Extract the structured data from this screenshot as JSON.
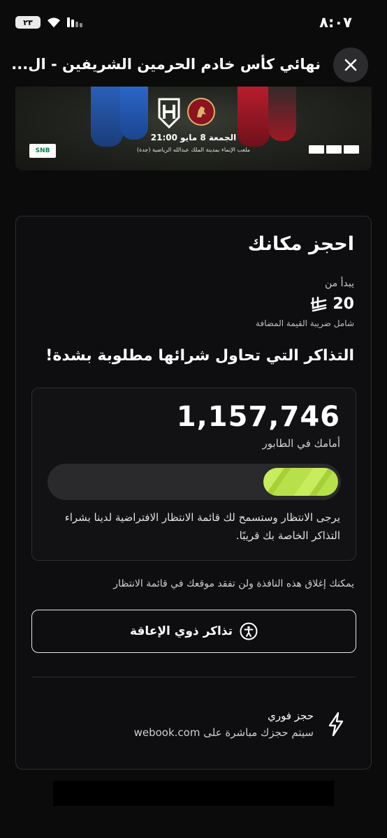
{
  "status_bar": {
    "time": "٨:٠٧",
    "battery": "٢٣",
    "icons": [
      "battery-icon",
      "wifi-icon",
      "signal-icon"
    ]
  },
  "header": {
    "title": "نهائي كأس خادم الحرمين الشريفين - ال...",
    "close_icon": "close-icon"
  },
  "banner": {
    "match_date": "الجمعة 8 مايو 21:00",
    "venue": "ملعب الإنماء بمدينة الملك عبدالله الرياضية (جدة)",
    "sponsor": "SNB",
    "team_badge": "AL KHOLOOD"
  },
  "booking": {
    "title": "احجز مكانك",
    "starts_from": "يبدأ من",
    "price": "20",
    "currency_icon": "riyal-icon",
    "vat_note": "شامل ضريبة القيمة المضافة",
    "demand_title": "التذاكر التي تحاول شرائها مطلوبة بشدة!"
  },
  "queue": {
    "position": "1,157,746",
    "position_label": "أمامك في الطابور",
    "progress": 0.26,
    "message": "يرجى الانتظار وستسمح لك قائمة الانتظار الافتراضية لدينا بشراء التذاكر الخاصة بك قريبًا."
  },
  "notes": {
    "close_window": "يمكنك إغلاق هذه النافذة ولن تفقد موقعك في قائمة الانتظار"
  },
  "accessible_button": {
    "label": "تذاكر ذوي الإعاقة",
    "icon": "accessibility-icon"
  },
  "instant_booking": {
    "title": "حجز فوري",
    "description": "سيتم حجزك مباشرة على webook.com",
    "icon": "lightning-icon"
  },
  "colors": {
    "background": "#0b0b0c",
    "accent": "#b8e04a",
    "card_border": "#2d2d30"
  }
}
